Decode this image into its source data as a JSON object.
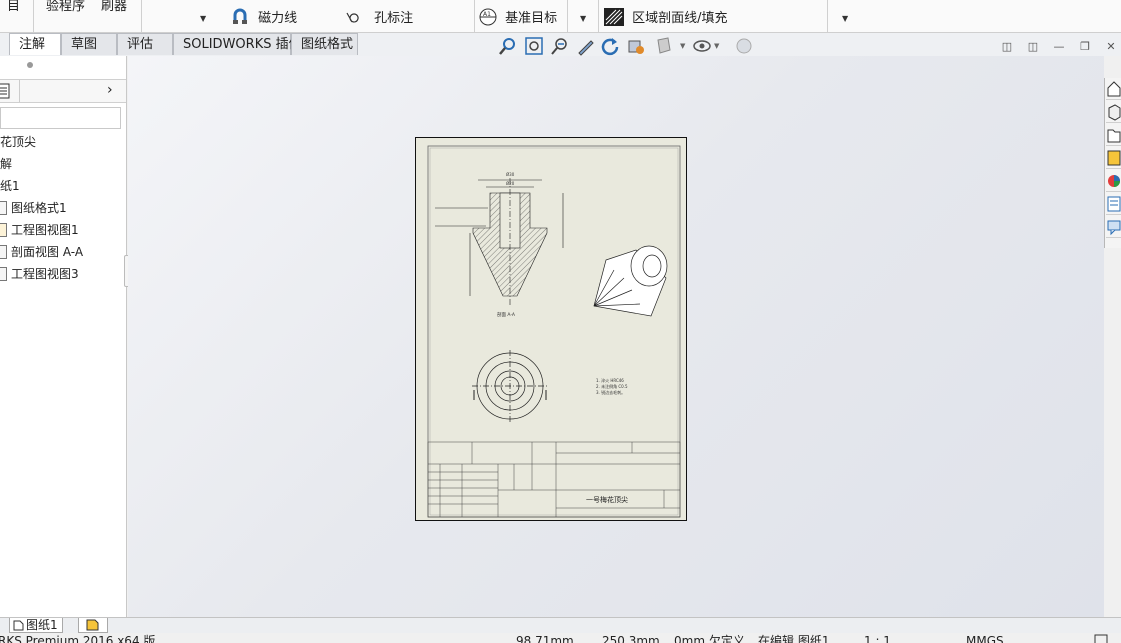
{
  "ribbon": {
    "partial_top_left": "目",
    "verify_label": "验程序",
    "brush_label": "刷器",
    "magnet_line_label": "磁力线",
    "hole_callout_label": "孔标注",
    "datum_target_label": "基准目标",
    "area_hatch_label": "区域剖面线/填充"
  },
  "tabs": [
    {
      "label": "注解",
      "active": true
    },
    {
      "label": "草图",
      "active": false
    },
    {
      "label": "评估",
      "active": false
    },
    {
      "label": "SOLIDWORKS 插件",
      "active": false
    },
    {
      "label": "图纸格式",
      "active": false
    }
  ],
  "tree": {
    "items": [
      {
        "label": "花顶尖"
      },
      {
        "label": "解"
      },
      {
        "label": "纸1"
      },
      {
        "label": "图纸格式1"
      },
      {
        "label": "工程图视图1"
      },
      {
        "label": "剖面视图 A-A"
      },
      {
        "label": "工程图视图3"
      }
    ]
  },
  "sheet_tabs": {
    "sheet1": "图纸1"
  },
  "statusbar": {
    "product": "RKS Premium 2016 x64 版",
    "x_coord": "98.71mm",
    "y_coord": "250.3mm",
    "z_coord": "0mm 欠定义",
    "editing": "在编辑 图纸1",
    "scale": "1 : 1",
    "units": "MMGS"
  },
  "drawing": {
    "section_label": "剖面 A-A",
    "title_block_name": "一号梅花顶尖",
    "notes": [
      "1. 淬火 HRC46",
      "2. 未注倒角 C0.5",
      "3. 锐边去毛刺。"
    ]
  },
  "colors": {
    "sheet_fill": "#e9e9dd",
    "accent_blue": "#2a6db3"
  }
}
